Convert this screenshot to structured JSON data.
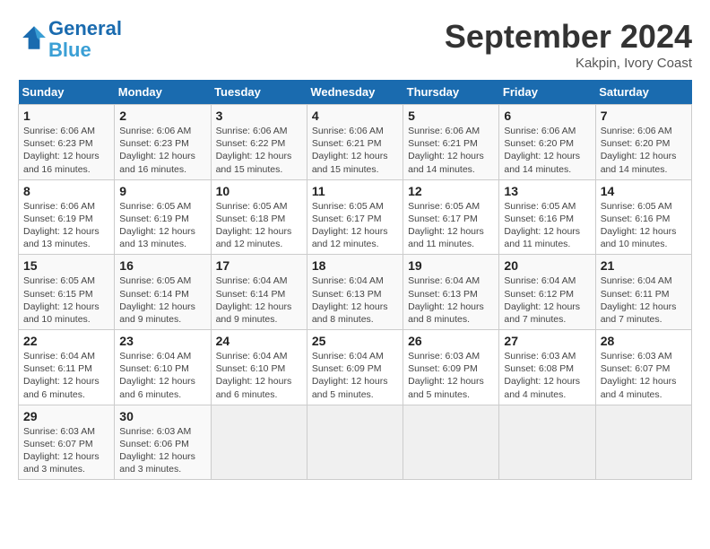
{
  "header": {
    "logo_line1": "General",
    "logo_line2": "Blue",
    "month": "September 2024",
    "location": "Kakpin, Ivory Coast"
  },
  "weekdays": [
    "Sunday",
    "Monday",
    "Tuesday",
    "Wednesday",
    "Thursday",
    "Friday",
    "Saturday"
  ],
  "weeks": [
    [
      {
        "day": "1",
        "detail": "Sunrise: 6:06 AM\nSunset: 6:23 PM\nDaylight: 12 hours\nand 16 minutes."
      },
      {
        "day": "2",
        "detail": "Sunrise: 6:06 AM\nSunset: 6:23 PM\nDaylight: 12 hours\nand 16 minutes."
      },
      {
        "day": "3",
        "detail": "Sunrise: 6:06 AM\nSunset: 6:22 PM\nDaylight: 12 hours\nand 15 minutes."
      },
      {
        "day": "4",
        "detail": "Sunrise: 6:06 AM\nSunset: 6:21 PM\nDaylight: 12 hours\nand 15 minutes."
      },
      {
        "day": "5",
        "detail": "Sunrise: 6:06 AM\nSunset: 6:21 PM\nDaylight: 12 hours\nand 14 minutes."
      },
      {
        "day": "6",
        "detail": "Sunrise: 6:06 AM\nSunset: 6:20 PM\nDaylight: 12 hours\nand 14 minutes."
      },
      {
        "day": "7",
        "detail": "Sunrise: 6:06 AM\nSunset: 6:20 PM\nDaylight: 12 hours\nand 14 minutes."
      }
    ],
    [
      {
        "day": "8",
        "detail": "Sunrise: 6:06 AM\nSunset: 6:19 PM\nDaylight: 12 hours\nand 13 minutes."
      },
      {
        "day": "9",
        "detail": "Sunrise: 6:05 AM\nSunset: 6:19 PM\nDaylight: 12 hours\nand 13 minutes."
      },
      {
        "day": "10",
        "detail": "Sunrise: 6:05 AM\nSunset: 6:18 PM\nDaylight: 12 hours\nand 12 minutes."
      },
      {
        "day": "11",
        "detail": "Sunrise: 6:05 AM\nSunset: 6:17 PM\nDaylight: 12 hours\nand 12 minutes."
      },
      {
        "day": "12",
        "detail": "Sunrise: 6:05 AM\nSunset: 6:17 PM\nDaylight: 12 hours\nand 11 minutes."
      },
      {
        "day": "13",
        "detail": "Sunrise: 6:05 AM\nSunset: 6:16 PM\nDaylight: 12 hours\nand 11 minutes."
      },
      {
        "day": "14",
        "detail": "Sunrise: 6:05 AM\nSunset: 6:16 PM\nDaylight: 12 hours\nand 10 minutes."
      }
    ],
    [
      {
        "day": "15",
        "detail": "Sunrise: 6:05 AM\nSunset: 6:15 PM\nDaylight: 12 hours\nand 10 minutes."
      },
      {
        "day": "16",
        "detail": "Sunrise: 6:05 AM\nSunset: 6:14 PM\nDaylight: 12 hours\nand 9 minutes."
      },
      {
        "day": "17",
        "detail": "Sunrise: 6:04 AM\nSunset: 6:14 PM\nDaylight: 12 hours\nand 9 minutes."
      },
      {
        "day": "18",
        "detail": "Sunrise: 6:04 AM\nSunset: 6:13 PM\nDaylight: 12 hours\nand 8 minutes."
      },
      {
        "day": "19",
        "detail": "Sunrise: 6:04 AM\nSunset: 6:13 PM\nDaylight: 12 hours\nand 8 minutes."
      },
      {
        "day": "20",
        "detail": "Sunrise: 6:04 AM\nSunset: 6:12 PM\nDaylight: 12 hours\nand 7 minutes."
      },
      {
        "day": "21",
        "detail": "Sunrise: 6:04 AM\nSunset: 6:11 PM\nDaylight: 12 hours\nand 7 minutes."
      }
    ],
    [
      {
        "day": "22",
        "detail": "Sunrise: 6:04 AM\nSunset: 6:11 PM\nDaylight: 12 hours\nand 6 minutes."
      },
      {
        "day": "23",
        "detail": "Sunrise: 6:04 AM\nSunset: 6:10 PM\nDaylight: 12 hours\nand 6 minutes."
      },
      {
        "day": "24",
        "detail": "Sunrise: 6:04 AM\nSunset: 6:10 PM\nDaylight: 12 hours\nand 6 minutes."
      },
      {
        "day": "25",
        "detail": "Sunrise: 6:04 AM\nSunset: 6:09 PM\nDaylight: 12 hours\nand 5 minutes."
      },
      {
        "day": "26",
        "detail": "Sunrise: 6:03 AM\nSunset: 6:09 PM\nDaylight: 12 hours\nand 5 minutes."
      },
      {
        "day": "27",
        "detail": "Sunrise: 6:03 AM\nSunset: 6:08 PM\nDaylight: 12 hours\nand 4 minutes."
      },
      {
        "day": "28",
        "detail": "Sunrise: 6:03 AM\nSunset: 6:07 PM\nDaylight: 12 hours\nand 4 minutes."
      }
    ],
    [
      {
        "day": "29",
        "detail": "Sunrise: 6:03 AM\nSunset: 6:07 PM\nDaylight: 12 hours\nand 3 minutes."
      },
      {
        "day": "30",
        "detail": "Sunrise: 6:03 AM\nSunset: 6:06 PM\nDaylight: 12 hours\nand 3 minutes."
      },
      {
        "day": "",
        "detail": ""
      },
      {
        "day": "",
        "detail": ""
      },
      {
        "day": "",
        "detail": ""
      },
      {
        "day": "",
        "detail": ""
      },
      {
        "day": "",
        "detail": ""
      }
    ]
  ]
}
